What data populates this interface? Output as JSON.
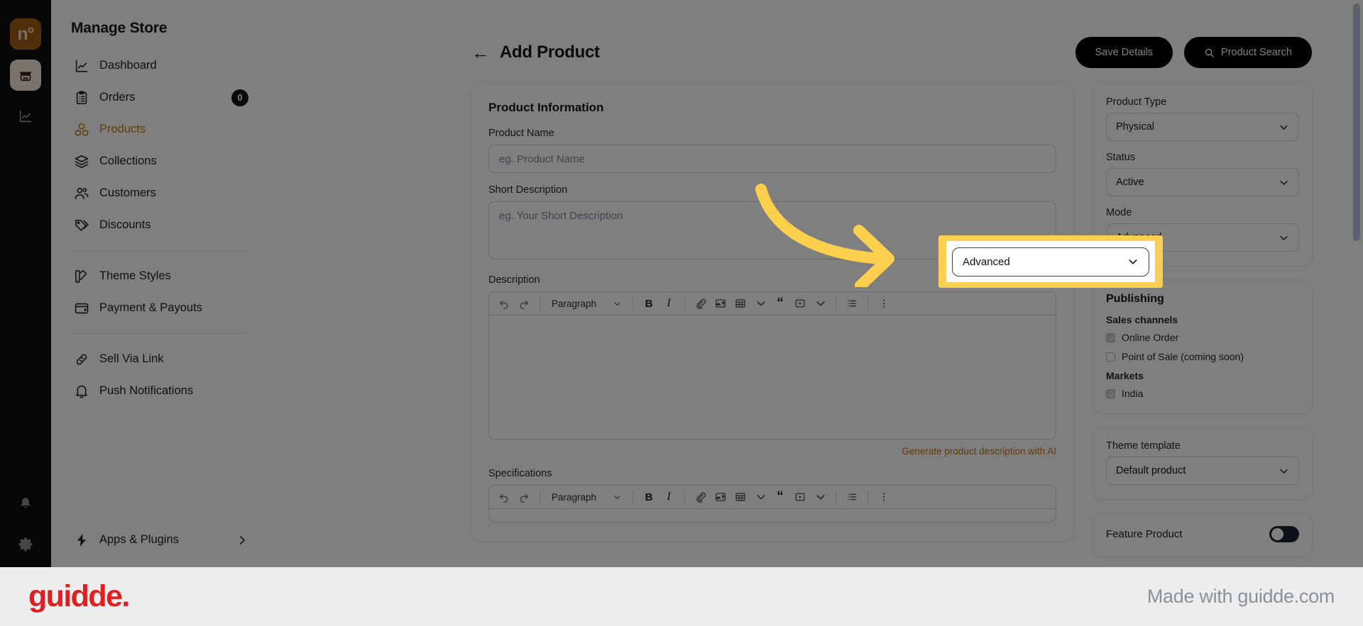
{
  "rail": {
    "logo_text": "n°",
    "items": [
      {
        "name": "store-icon",
        "label": "Store"
      },
      {
        "name": "analytics-icon",
        "label": "Analytics"
      }
    ],
    "bottom": [
      {
        "name": "bell-icon",
        "label": "Notifications"
      },
      {
        "name": "gear-icon",
        "label": "Settings"
      }
    ]
  },
  "sidebar": {
    "title": "Manage Store",
    "items": [
      {
        "label": "Dashboard",
        "icon": "chart-line-icon",
        "active": false,
        "badge": null
      },
      {
        "label": "Orders",
        "icon": "clipboard-list-icon",
        "active": false,
        "badge": "0"
      },
      {
        "label": "Products",
        "icon": "boxes-icon",
        "active": true,
        "badge": null
      },
      {
        "label": "Collections",
        "icon": "layers-icon",
        "active": false,
        "badge": null
      },
      {
        "label": "Customers",
        "icon": "users-icon",
        "active": false,
        "badge": null
      },
      {
        "label": "Discounts",
        "icon": "tag-icon",
        "active": false,
        "badge": null
      }
    ],
    "items_group2": [
      {
        "label": "Theme Styles",
        "icon": "palette-icon"
      },
      {
        "label": "Payment & Payouts",
        "icon": "wallet-icon"
      }
    ],
    "items_group3": [
      {
        "label": "Sell Via Link",
        "icon": "link-icon"
      },
      {
        "label": "Push Notifications",
        "icon": "bell-icon"
      }
    ],
    "footer_item": {
      "label": "Apps & Plugins",
      "icon": "bolt-icon",
      "chevron": "chevron-right-icon"
    }
  },
  "header": {
    "back_icon": "←",
    "title": "Add Product",
    "save_label": "Save Details",
    "search_label": "Product Search",
    "search_icon": "search-icon"
  },
  "product_info": {
    "card_title": "Product Information",
    "name_label": "Product Name",
    "name_value": "",
    "name_placeholder": "eg. Product Name",
    "short_desc_label": "Short Description",
    "short_desc_value": "",
    "short_desc_placeholder": "eg. Your Short Description",
    "description_label": "Description",
    "ai_link": "Generate product description with AI",
    "specifications_label": "Specifications"
  },
  "editor_toolbar": {
    "undo": "undo-icon",
    "redo": "redo-icon",
    "block_format": "Paragraph",
    "bold": "B",
    "italic": "I",
    "link": "link-icon",
    "image": "image-upload-icon",
    "table": "table-icon",
    "quote": "“",
    "video": "video-icon",
    "list": "bullet-list-icon",
    "more": "more-vertical-icon"
  },
  "side": {
    "product_type_label": "Product Type",
    "product_type_value": "Physical",
    "status_label": "Status",
    "status_value": "Active",
    "mode_label": "Mode",
    "mode_value": "Advanced",
    "publishing_title": "Publishing",
    "sales_channels_title": "Sales channels",
    "sales_channels": [
      {
        "label": "Online Order",
        "checked": true
      },
      {
        "label": "Point of Sale (coming soon)",
        "checked": false
      }
    ],
    "markets_title": "Markets",
    "markets": [
      {
        "label": "India",
        "checked": true
      }
    ],
    "theme_template_label": "Theme template",
    "theme_template_value": "Default product",
    "feature_product_label": "Feature Product",
    "feature_product_on": false
  },
  "footer": {
    "brand": "guidde.",
    "made_with": "Made with guidde.com"
  },
  "colors": {
    "accent_orange": "#bf7d1c",
    "highlight_yellow": "#fbcf51",
    "arrow_yellow": "#fccf4d",
    "brand_red": "#e02020",
    "dark_button": "#000000"
  }
}
